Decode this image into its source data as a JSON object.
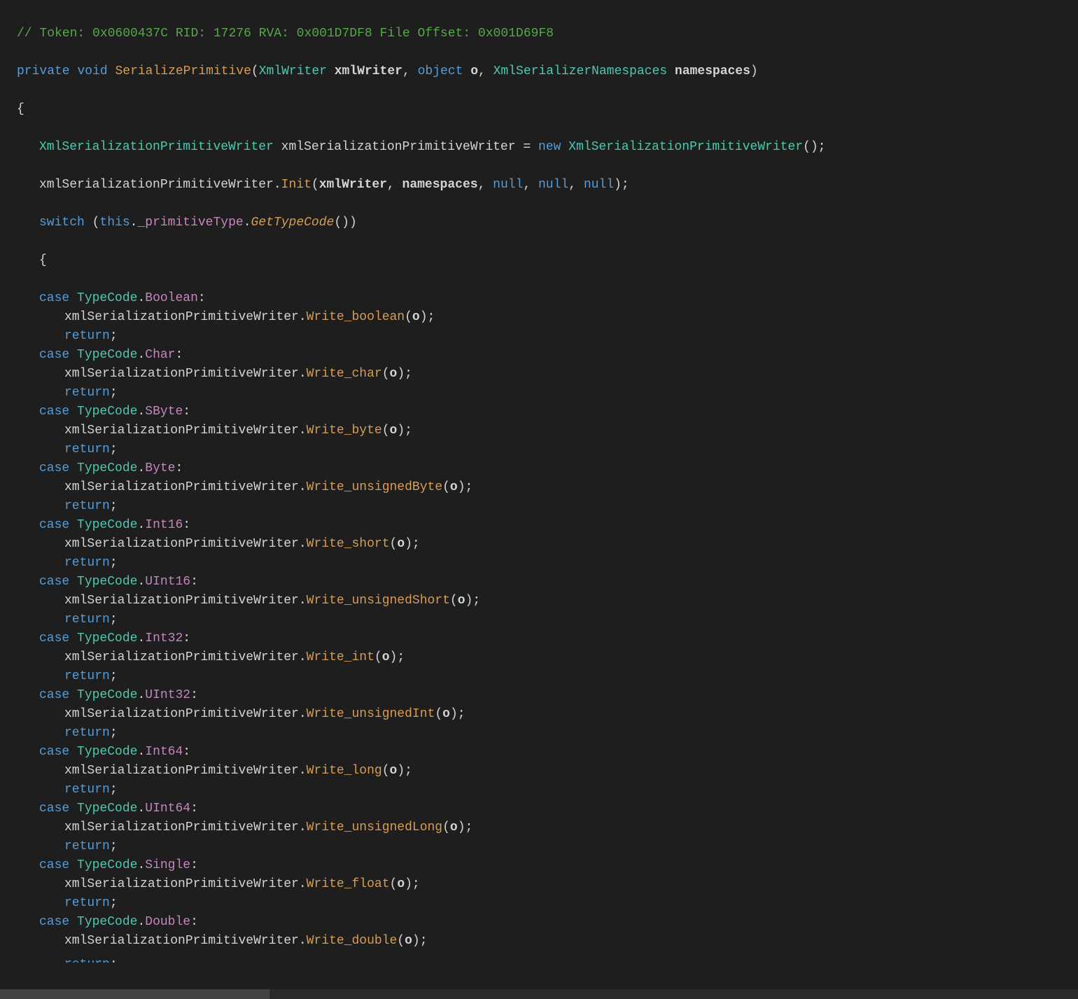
{
  "comment": "// Token: 0x0600437C RID: 17276 RVA: 0x001D7DF8 File Offset: 0x001D69F8",
  "kw": {
    "private": "private",
    "void": "void",
    "object": "object",
    "new": "new",
    "null": "null",
    "switch": "switch",
    "this": "this",
    "case": "case",
    "return": "return"
  },
  "sig": {
    "name": "SerializePrimitive",
    "p1type": "XmlWriter",
    "p1name": "xmlWriter",
    "p2name": "o",
    "p3type": "XmlSerializerNamespaces",
    "p3name": "namespaces"
  },
  "body": {
    "writerType": "XmlSerializationPrimitiveWriter",
    "writerVar": "xmlSerializationPrimitiveWriter",
    "initMethod": "Init",
    "primField": "_primitiveType",
    "getTypeCode": "GetTypeCode",
    "typeCode": "TypeCode"
  },
  "cases": [
    {
      "code": "Boolean",
      "method": "Write_boolean"
    },
    {
      "code": "Char",
      "method": "Write_char"
    },
    {
      "code": "SByte",
      "method": "Write_byte"
    },
    {
      "code": "Byte",
      "method": "Write_unsignedByte"
    },
    {
      "code": "Int16",
      "method": "Write_short"
    },
    {
      "code": "UInt16",
      "method": "Write_unsignedShort"
    },
    {
      "code": "Int32",
      "method": "Write_int"
    },
    {
      "code": "UInt32",
      "method": "Write_unsignedInt"
    },
    {
      "code": "Int64",
      "method": "Write_long"
    },
    {
      "code": "UInt64",
      "method": "Write_unsignedLong"
    },
    {
      "code": "Single",
      "method": "Write_float"
    },
    {
      "code": "Double",
      "method": "Write_double"
    }
  ]
}
